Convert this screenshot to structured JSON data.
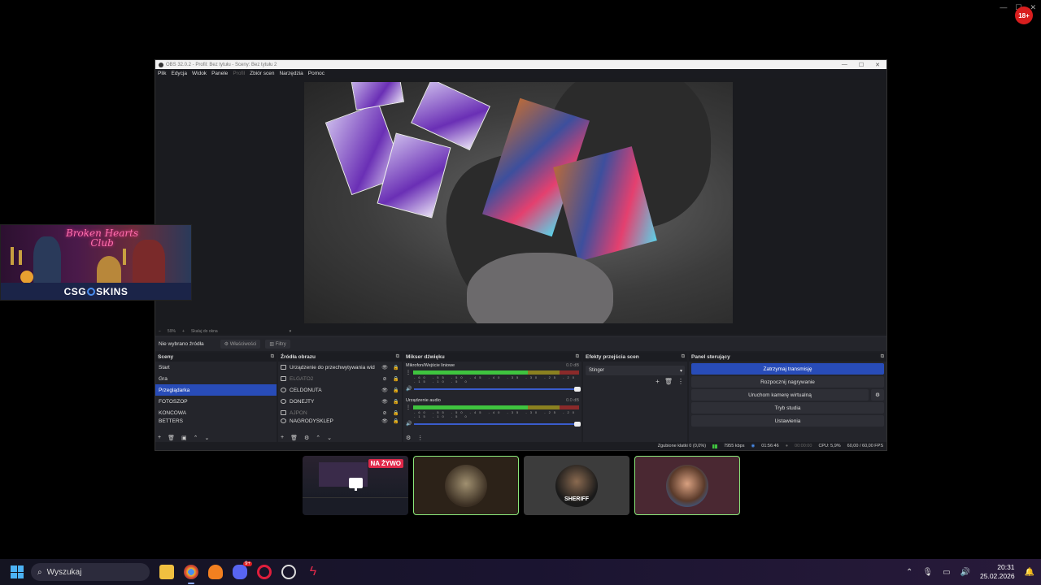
{
  "top_badge": "18+",
  "obs": {
    "title": "OBS 32.0.2 - Profil: Bez tytułu - Sceny: Bez tytułu 2",
    "menu": [
      "Plik",
      "Edycja",
      "Widok",
      "Panele",
      "Profil",
      "Zbiór scen",
      "Narzędzia",
      "Pomoc"
    ],
    "preview_status": {
      "zoom": "59%",
      "mode": "Skaluj do okna"
    },
    "source_toolbar": {
      "label": "Nie wybrano źródła",
      "properties": "Właściwości",
      "filters": "Filtry"
    },
    "scenes": {
      "title": "Sceny",
      "items": [
        "Start",
        "Gra",
        "Przeglądarka",
        "FOTOSZOP",
        "KONCOWA",
        "BETTERS"
      ],
      "selected_index": 2
    },
    "sources": {
      "title": "Źródła obrazu",
      "items": [
        {
          "label": "Urządzenie do przechwytywania wid",
          "visible": true
        },
        {
          "label": "ELGATO2",
          "visible": false
        },
        {
          "label": "CELDONUTA",
          "visible": true
        },
        {
          "label": "DONEJTY",
          "visible": true
        },
        {
          "label": "AJPON",
          "visible": false
        },
        {
          "label": "NAGRODYSKLEP",
          "visible": true
        }
      ]
    },
    "mixer": {
      "title": "Mikser dźwięku",
      "channels": [
        {
          "name": "Mikrofon/Wejście liniowe",
          "db": "0.0 dB",
          "level": 0.69
        },
        {
          "name": "Urządzenie audio",
          "db": "0.0 dB",
          "level": 0.69
        }
      ],
      "ticks": "-60 -55 -50 -45 -40 -35 -30 -25 -20 -15 -10 -5 0"
    },
    "transitions": {
      "title": "Efekty przejścia scen",
      "selected": "Stinger"
    },
    "controls": {
      "title": "Panel sterujący",
      "stop_stream": "Zatrzymaj transmisję",
      "start_recording": "Rozpocznij nagrywanie",
      "virtual_cam": "Uruchom kamerę wirtualną",
      "studio_mode": "Tryb studia",
      "settings": "Ustawienia"
    },
    "status": {
      "dropped": "Zgubione klatki 0 (0,0%)",
      "bitrate": "7955 kbps",
      "live_time": "01:56:46",
      "rec_time": "00:00:00",
      "cpu": "CPU: 5,9%",
      "fps": "60,00 / 60,00 FPS"
    }
  },
  "overlay": {
    "neon_title_1": "Broken Hearts",
    "neon_title_2": "Club",
    "brand_left": "CSG",
    "brand_right": "SKINS"
  },
  "tiles": {
    "live_badge": "NA ŻYWO",
    "sheriff_label": "SHERIFF"
  },
  "taskbar": {
    "search_placeholder": "Wyszukaj",
    "discord_badge": "9+",
    "time": "20:31",
    "date": "25.02.2026"
  }
}
